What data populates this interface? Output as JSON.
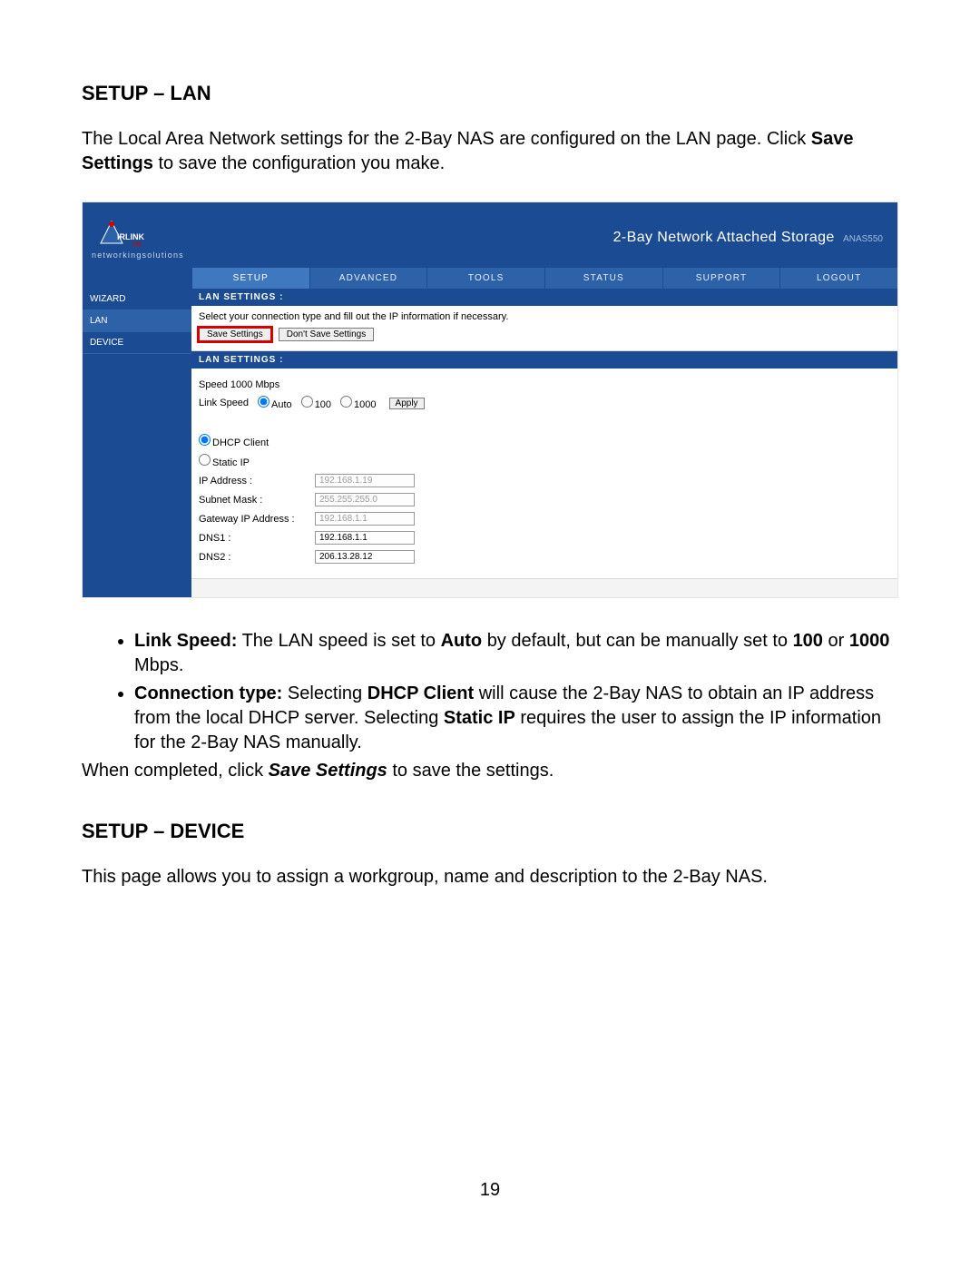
{
  "doc": {
    "sectionA_title": "SETUP – LAN",
    "intro_text": "The Local Area Network settings for the 2-Bay NAS are configured on the LAN page. Click ",
    "intro_bold": "Save Settings",
    "intro_tail": " to save the configuration you make.",
    "sectionB_title": "SETUP – DEVICE",
    "outro": "This page allows you to assign a workgroup, name and description to the 2-Bay NAS.",
    "closing": "When completed, click ",
    "closing_bold": "Save Settings",
    "closing_tail": " to save the settings.",
    "page_number": "19",
    "bullets": [
      {
        "lead": "Link Speed:",
        "t1": " The LAN speed is set to ",
        "b1": "Auto",
        "t2": " by default, but can be manually set to ",
        "b2": "100",
        "t3": " or ",
        "b3": "1000",
        "t4": " Mbps."
      },
      {
        "lead": "Connection type:",
        "t1": " Selecting ",
        "b1": "DHCP Client",
        "t2": " will cause the 2-Bay NAS to obtain an IP address from the local DHCP server. Selecting ",
        "b2": "Static IP",
        "t3": " requires the user to assign the IP information for the 2-Bay NAS manually."
      }
    ]
  },
  "ui": {
    "brand_tagline": "networkingsolutions",
    "product_title": "2-Bay Network Attached Storage",
    "product_model": "ANAS550",
    "nav": [
      "SETUP",
      "ADVANCED",
      "TOOLS",
      "STATUS",
      "SUPPORT",
      "LOGOUT"
    ],
    "sidebar": [
      "WIZARD",
      "LAN",
      "DEVICE"
    ],
    "panel_title": "LAN SETTINGS :",
    "panel_instruction": "Select your connection type and fill out the IP information if necessary.",
    "save_btn": "Save Settings",
    "dont_save_btn": "Don't Save Settings",
    "speed_text": "Speed 1000 Mbps",
    "link_speed_label": "Link Speed",
    "speed_options": {
      "auto": "Auto",
      "o100": "100",
      "o1000": "1000"
    },
    "apply_btn": "Apply",
    "conn": {
      "dhcp": "DHCP Client",
      "static": "Static IP"
    },
    "fields": {
      "ip_label": "IP Address :",
      "ip_value": "192.168.1.19",
      "mask_label": "Subnet Mask :",
      "mask_value": "255.255.255.0",
      "gw_label": "Gateway IP Address :",
      "gw_value": "192.168.1.1",
      "dns1_label": "DNS1 :",
      "dns1_value": "192.168.1.1",
      "dns2_label": "DNS2 :",
      "dns2_value": "206.13.28.12"
    }
  }
}
